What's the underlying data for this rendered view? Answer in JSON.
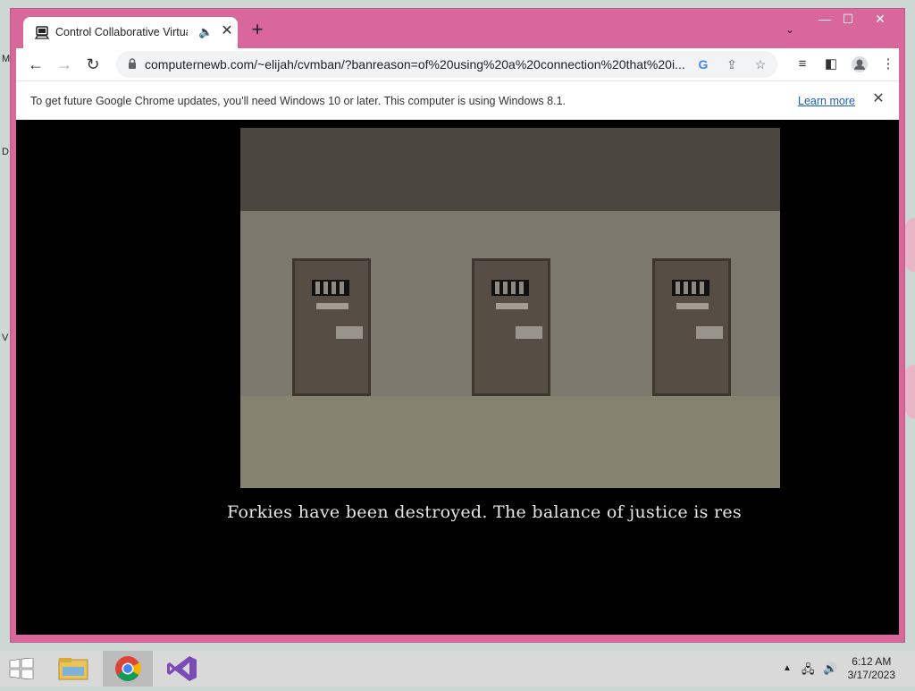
{
  "desktop": {
    "side_letters": [
      "M",
      "D",
      "V"
    ]
  },
  "browser": {
    "tab": {
      "title": "Control Collaborative Virtual",
      "audio_icon": "speaker-icon"
    },
    "new_tab_label": "+",
    "window_controls": {
      "minimize": "—",
      "maximize": "☐",
      "close": "✕"
    },
    "address_bar": {
      "url": "computernewb.com/~elijah/cvmban/?banreason=of%20using%20a%20connection%20that%20i..."
    },
    "infobar": {
      "message": "To get future Google Chrome updates, you'll need Windows 10 or later. This computer is using Windows 8.1.",
      "link": "Learn more"
    }
  },
  "game": {
    "caption": "Forkies have been destroyed. The balance of justice is res",
    "doors": 3,
    "colors": {
      "ceiling": "#4b4640",
      "wall": "#7c786d",
      "floor": "#85826f",
      "door": "#564d45"
    }
  },
  "taskbar": {
    "apps": [
      "file-explorer",
      "google-chrome",
      "visual-studio"
    ],
    "time": "6:12 AM",
    "date": "3/17/2023"
  }
}
